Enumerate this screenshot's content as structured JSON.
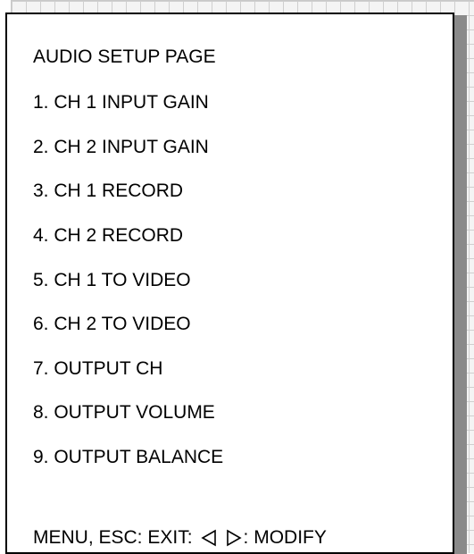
{
  "osd": {
    "title": "AUDIO SETUP PAGE",
    "items": [
      {
        "label": "1. CH 1 INPUT GAIN"
      },
      {
        "label": "2. CH 2 INPUT GAIN"
      },
      {
        "label": "3. CH 1 RECORD"
      },
      {
        "label": "4. CH 2 RECORD"
      },
      {
        "label": "5. CH 1 TO VIDEO"
      },
      {
        "label": "6. CH 2 TO VIDEO"
      },
      {
        "label": "7. OUTPUT CH"
      },
      {
        "label": "8. OUTPUT VOLUME"
      },
      {
        "label": "9. OUTPUT BALANCE"
      }
    ],
    "footer": {
      "exit_text": "MENU, ESC: EXIT:",
      "left_icon": "left-triangle-outline",
      "right_icon": "right-triangle-outline",
      "modify_text": ": MODIFY"
    }
  }
}
